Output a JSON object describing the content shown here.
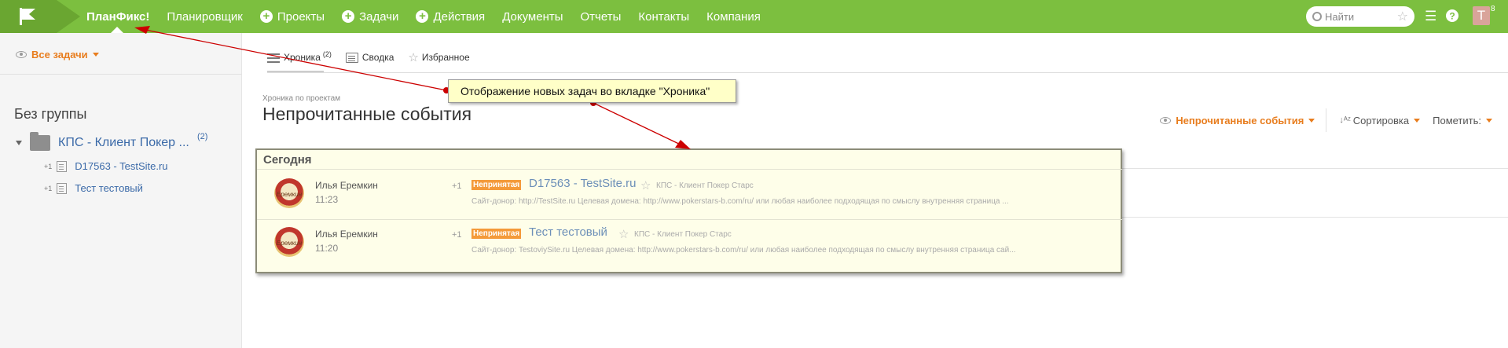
{
  "topbar": {
    "brand": "ПланФикс!",
    "nav": [
      {
        "label": "Планировщик",
        "plus": false
      },
      {
        "label": "Проекты",
        "plus": true
      },
      {
        "label": "Задачи",
        "plus": true
      },
      {
        "label": "Действия",
        "plus": true
      },
      {
        "label": "Документы",
        "plus": false
      },
      {
        "label": "Отчеты",
        "plus": false
      },
      {
        "label": "Контакты",
        "plus": false
      },
      {
        "label": "Компания",
        "plus": false
      }
    ],
    "search_placeholder": "Найти",
    "avatar_letter": "T",
    "avatar_badge": "8"
  },
  "sidebar": {
    "filter_label": "Все задачи",
    "group_title": "Без группы",
    "project": {
      "name": "КПС - Клиент Покер ...",
      "count": "(2)"
    },
    "tasks": [
      {
        "plus": "+1",
        "name": "D17563 - TestSite.ru"
      },
      {
        "plus": "+1",
        "name": "Тест тестовый"
      }
    ]
  },
  "main": {
    "tabs": [
      {
        "label": "Хроника",
        "sup": "(2)"
      },
      {
        "label": "Сводка",
        "sup": ""
      },
      {
        "label": "Избранное",
        "sup": ""
      }
    ],
    "subtitle": "Хроника по проектам",
    "title": "Непрочитанные события",
    "controls": {
      "unread": "Непрочитанные события",
      "sort": "Сортировка",
      "mark": "Пометить:"
    },
    "today_label": "Сегодня",
    "events": [
      {
        "avatar_text": "Еремкин",
        "author": "Илья Еремкин",
        "time": "11:23",
        "plus": "+1",
        "badge": "Непринятая",
        "title": "D17563 - TestSite.ru",
        "project": "КПС - Клиент Покер Старс",
        "desc": "Сайт-донор: http://TestSite.ru Целевая домена: http://www.pokerstars-b.com/ru/ или любая наиболее подходящая по смыслу внутренняя страница ..."
      },
      {
        "avatar_text": "Еремкин",
        "author": "Илья Еремкин",
        "time": "11:20",
        "plus": "+1",
        "badge": "Непринятая",
        "title": "Тест тестовый",
        "project": "КПС - Клиент Покер Старс",
        "desc": "Сайт-донор: TestoviySite.ru Целевая домена: http://www.pokerstars-b.com/ru/ или любая наиболее подходящая по смыслу внутренняя страница сай..."
      }
    ]
  },
  "annotation": {
    "callout_text": "Отображение новых задач во вкладке \"Хроника\"",
    "color": "#cc0000"
  },
  "colors": {
    "topbar": "#7cbf3f",
    "accent_orange": "#e87d1e",
    "link_blue": "#3b6aa8"
  }
}
